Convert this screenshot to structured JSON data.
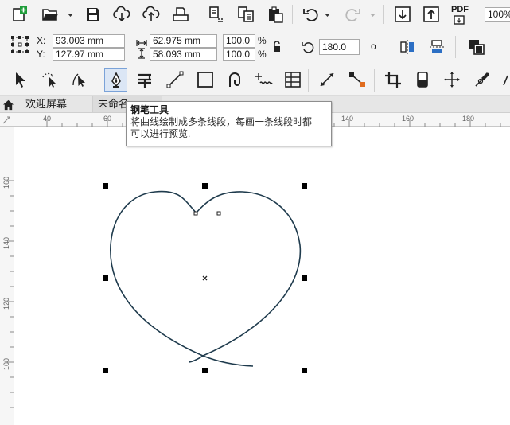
{
  "standard_toolbar": {
    "icons": [
      "new-document-icon",
      "open-folder-icon",
      "save-icon",
      "download-cloud-icon",
      "upload-cloud-icon",
      "print-icon",
      "cut-icon",
      "copy-icon",
      "paste-icon",
      "undo-icon",
      "redo-icon",
      "import-icon",
      "export-icon",
      "pdf-export-icon"
    ],
    "pdf_label": "PDF",
    "zoom_value": "100%"
  },
  "property_bar": {
    "x_label": "X:",
    "y_label": "Y:",
    "x_value": "93.003 mm",
    "y_value": "127.97 mm",
    "width_value": "62.975 mm",
    "height_value": "58.093 mm",
    "scale_x": "100.0",
    "scale_y": "100.0",
    "percent_x": "%",
    "percent_y": "%",
    "rotation": "180.0",
    "degree_symbol": "o"
  },
  "toolbox": {
    "active_tool": "pen-tool",
    "tools": [
      "pick-tool",
      "freehand-pick-tool",
      "shape-tool",
      "pen-tool",
      "text-tool",
      "line-tool",
      "rectangle-tool",
      "spiral-tool",
      "smart-drawing-tool",
      "table-tool",
      "dimension-tool",
      "connector-tool",
      "crop-tool",
      "eraser-tool",
      "transform-tool",
      "knife-tool"
    ]
  },
  "tabs": {
    "home_label": "欢迎屏幕",
    "document_label": "未命名",
    "add_label": "+"
  },
  "tooltip": {
    "title": "钢笔工具",
    "line1": "将曲线绘制成多条线段，每画一条线段时都",
    "line2": "可以进行预览."
  },
  "rulers": {
    "horizontal": [
      "40",
      "60",
      "140",
      "160",
      "180"
    ],
    "vertical": [
      "160",
      "140",
      "120",
      "100"
    ]
  },
  "colors": {
    "accent": "#2c6fc4",
    "curve": "#1f3b4d",
    "handle": "#000000"
  }
}
